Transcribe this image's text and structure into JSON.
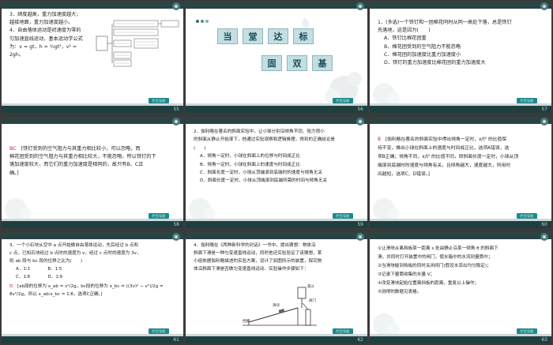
{
  "slides": [
    {
      "page": "55",
      "lines": [
        "3．缔度越高，重力加速度越大；",
        "越接地面，重力加速度越小。",
        "4．自由落体运动是初速度为零的",
        "匀加速直线运动，基本运动学公式",
        "为：v = gt，h = ½gt²，v² = 2gh。"
      ],
      "diagram_labels": [
        "研究对象 ①",
        "②",
        "③",
        "④"
      ]
    },
    {
      "page": "56",
      "title_chars": [
        "当",
        "堂",
        "达",
        "标"
      ],
      "subtitle_chars": [
        "固",
        "双",
        "基"
      ]
    },
    {
      "page": "57",
      "lines": [
        "1．(多选)一个铁钉和一团棉花同时从同一高处下落，总是铁钉",
        "先落地，这是因为(　　)",
        "A．铁钉比棉花团重",
        "B．棉花团受到的空气阻力不能忽略",
        "C．棉花团的加速度比重力加速度小",
        "D．铁钉的重力加速度比棉花团的重力加速度大"
      ]
    },
    {
      "page": "58",
      "answer": "BC",
      "lines": [
        "[铁钉受到的空气阻力与其重力相比较小，可以忽略，而",
        "棉花团受到的空气阻力与其重力相比较大，不能忽略，所以铁钉的下",
        "落加速度较大，而它们的重力加速度是相同的，故只有B、C正",
        "确。]"
      ]
    },
    {
      "page": "59",
      "lines": [
        "2．伽利略在著名的斜面实验中，让小球分别沿倾角不同、阻力很小",
        "的斜面从静止开始滚下，他通过实验观察和逻辑推理，得到的正确结论是",
        "(　　)",
        "A．倾角一定时，小球在斜面上的位移与时间成正比",
        "B．倾角一定时，小球在斜面上的速度与时间成正比",
        "C．斜面长度一定时，小球从顶端滚到底端时的速度与倾角无关",
        "D．斜面长度一定时，小球从顶端滚到底端所需的时间与倾角无关"
      ]
    },
    {
      "page": "60",
      "answer": "B",
      "lines": [
        "[伽利略在著名的斜面实验中得出倾角一定时，x/t² 的比值保",
        "持不变，推出小球在斜面上的速度与时间成正比，选项A错误，选",
        "项B正确；倾角不同，x/t² 的比值不同，即斜面长度一定时，小球从顶",
        "端滚到底端时的速度与倾角有关，且倾角越大，速度越大，所用时",
        "间越短，选项C、D错误。]"
      ]
    },
    {
      "page": "61",
      "lines": [
        "3．一个小石块从空中 a 点开始做自由落体运动，先后经过 b 点和",
        "c 点，已知石块经过 b 点时的速度为 v，经过 c 点时的速度为 3v，",
        "则 ab 段与 bc 段的位移之比为(　　)",
        "A．1∶3　　　　B．1∶5",
        "C．1∶8　　　　D．1∶9"
      ],
      "answer": "D",
      "answer_text": "[ab段的位移为 x_ab = v²/2g，bc段的位移为 x_bc = ((3v)² − v²)/2g = 8v²/2g，所以 x_ab∶x_bc = 1∶8，选项C正确。]"
    },
    {
      "page": "62",
      "lines": [
        "4．伽利略在《两种新科学的对话》一书中，提出猜想：物体沿",
        "斜面下滑是一种匀变速直线运动，同时他还实验验证了该猜想，某",
        "小组依据伽利略描述的实验方案，设计了如图所示的装置，探究物",
        "体沿斜面下滑是否做匀变速直线运动．实验操作步骤如下："
      ],
      "figure_labels": [
        "挡板",
        "阀门",
        "滑块",
        "漏斗"
      ]
    },
    {
      "page": "63",
      "lines": [
        "①让滑块从离挡板某一距离 s 处由静止沿某一倾角 θ 的斜面下",
        "滑，并同时打开装置中的阀门，使水箱中的水流到量筒中；",
        "②当滑块碰到挡板的同时关闭阀门(假设水流出均匀稳定)；",
        "③记录下量筒收集的水量 V；",
        "④改变滑块起始位置离挡板的距离，重复以上操作；",
        "⑤测得的数据见表格。"
      ]
    }
  ],
  "footer_button": "栏目导航",
  "footer_left": "ꙮ",
  "colors": {
    "band": "#1f3f3f",
    "accent": "#1e8a8a",
    "answer": "#c0202a"
  }
}
